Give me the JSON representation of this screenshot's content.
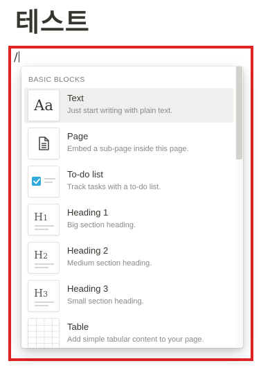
{
  "page": {
    "title": "테스트"
  },
  "editor": {
    "typed_text": "/"
  },
  "block_menu": {
    "section_label": "BASIC BLOCKS",
    "items": [
      {
        "title": "Text",
        "description": "Just start writing with plain text.",
        "icon": "text-aa-icon",
        "icon_text": "Aa"
      },
      {
        "title": "Page",
        "description": "Embed a sub-page inside this page.",
        "icon": "page-document-icon"
      },
      {
        "title": "To-do list",
        "description": "Track tasks with a to-do list.",
        "icon": "checkbox-icon"
      },
      {
        "title": "Heading 1",
        "description": "Big section heading.",
        "icon": "heading-1-icon",
        "icon_text": "H",
        "icon_sub": "1"
      },
      {
        "title": "Heading 2",
        "description": "Medium section heading.",
        "icon": "heading-2-icon",
        "icon_text": "H",
        "icon_sub": "2"
      },
      {
        "title": "Heading 3",
        "description": "Small section heading.",
        "icon": "heading-3-icon",
        "icon_text": "H",
        "icon_sub": "3"
      },
      {
        "title": "Table",
        "description": "Add simple tabular content to your page.",
        "icon": "table-grid-icon"
      }
    ],
    "selected_index": 0
  },
  "colors": {
    "highlight_frame": "#e02424",
    "checkbox_blue": "#2eaadc",
    "text_primary": "#37352f",
    "text_secondary": "#8a8985",
    "hover_bg": "#efefee"
  }
}
